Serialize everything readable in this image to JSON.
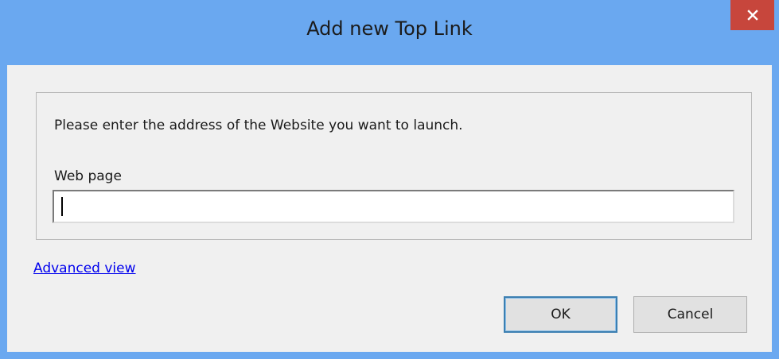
{
  "window": {
    "title": "Add new Top Link",
    "close_icon": "close-icon"
  },
  "dialog": {
    "prompt": "Please enter the address of the Website you want to launch.",
    "field_label": "Web page",
    "input_value": "",
    "input_placeholder": "",
    "advanced_link": "Advanced view",
    "ok_label": "OK",
    "cancel_label": "Cancel"
  },
  "colors": {
    "titlebar": "#6aa8f0",
    "close_button": "#c7463c",
    "link": "#0000ee",
    "client_bg": "#f0f0f0"
  }
}
